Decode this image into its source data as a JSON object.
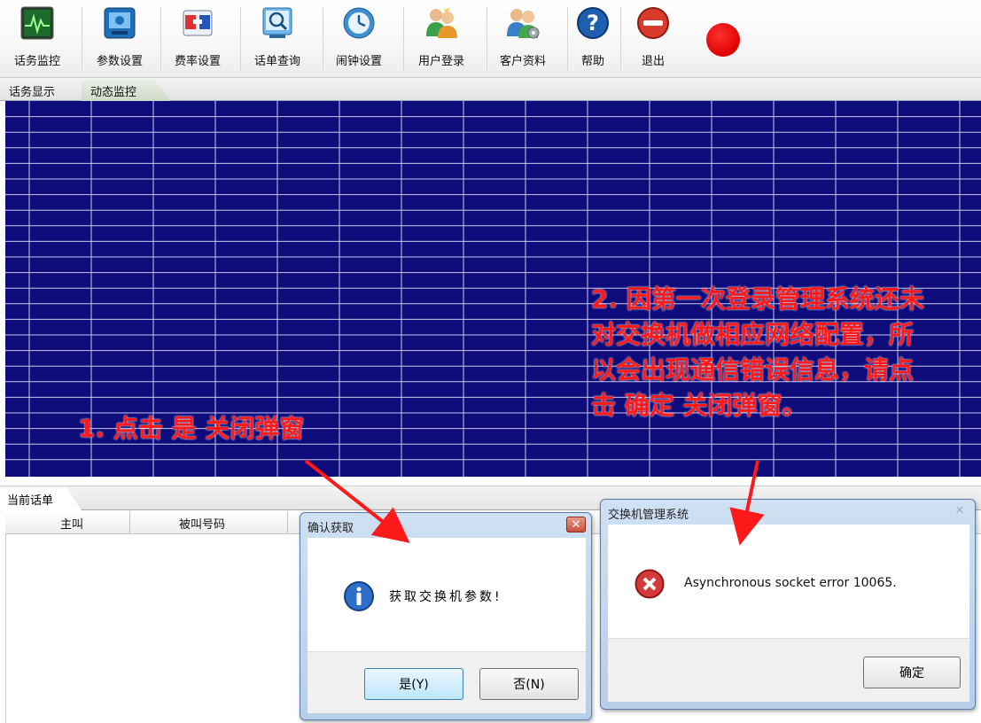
{
  "toolbar": {
    "items": [
      {
        "label": "话务监控",
        "icon": "monitor-icon"
      },
      {
        "label": "参数设置",
        "icon": "settings-screen-icon"
      },
      {
        "label": "费率设置",
        "icon": "rate-icon"
      },
      {
        "label": "话单查询",
        "icon": "search-record-icon"
      },
      {
        "label": "闹钟设置",
        "icon": "clock-icon"
      },
      {
        "label": "用户登录",
        "icon": "user-login-icon"
      },
      {
        "label": "客户资料",
        "icon": "customer-icon"
      },
      {
        "label": "帮助",
        "icon": "help-icon"
      },
      {
        "label": "退出",
        "icon": "exit-icon"
      }
    ],
    "record_indicator": {
      "icon": "record-dot-icon",
      "color": "#e00000"
    }
  },
  "tabs": {
    "primary": "话务显示",
    "secondary": "动态监控"
  },
  "bottom": {
    "tab": "当前话单",
    "columns": [
      "主叫",
      "被叫号码"
    ]
  },
  "confirm_dialog": {
    "title": "确认获取",
    "close": "✕",
    "message": "获取交换机参数!",
    "icon": "info-icon",
    "yes_label": "是(Y)",
    "no_label": "否(N)"
  },
  "error_dialog": {
    "title": "交换机管理系统",
    "close": "✕",
    "message": "Asynchronous socket error 10065.",
    "icon": "error-icon",
    "ok_label": "确定"
  },
  "annotations": {
    "step1": "1. 点击 是 关闭弹窗",
    "step2": "2. 因第一次登录管理系统还未对交换机做相应网络配置，所以会出现通信错误信息，请点击 确定 关闭弹窗。"
  },
  "colors": {
    "grid_bg": "#0e0c7a",
    "annotation": "#ff1a1a"
  }
}
